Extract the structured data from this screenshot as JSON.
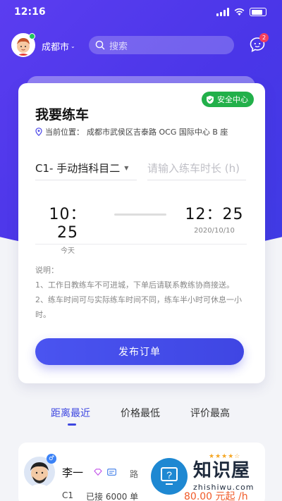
{
  "status_bar": {
    "time": "12:16"
  },
  "header": {
    "city": "成都市",
    "search_placeholder": "搜索",
    "message_badge": "2"
  },
  "card": {
    "safety_label": "安全中心",
    "title": "我要练车",
    "location_label": "当前位置：",
    "location_value": "成都市武侯区吉泰路 OCG 国际中心 B 座",
    "subject": "C1- 手动挡科目二",
    "duration_placeholder": "请输入练车时长 (h)",
    "start_time": "10：25",
    "start_day": "今天",
    "end_time": "12：25",
    "end_day": "2020/10/10",
    "notes": [
      "说明：",
      "1、工作日教练车不可进城，下单后请联系教练协商接送。",
      "2、练车时间可与实际练车时间不同，练车半小时可休息一小时。"
    ],
    "publish_label": "发布订单"
  },
  "tabs": [
    {
      "label": "距离最近",
      "active": true
    },
    {
      "label": "价格最低",
      "active": false
    },
    {
      "label": "评价最高",
      "active": false
    }
  ],
  "coach": {
    "gender_symbol": "♂",
    "name": "李一",
    "route": "路",
    "rating": 4,
    "license": "C1",
    "orders": "已接 6000 单",
    "price": "80.00 元起 /h"
  },
  "watermark": {
    "title": "知识屋",
    "subtitle": "zhishiwu.com"
  },
  "colors": {
    "primary": "#4a46e8",
    "safe_green": "#22b04a",
    "price_orange": "#f05a28"
  }
}
